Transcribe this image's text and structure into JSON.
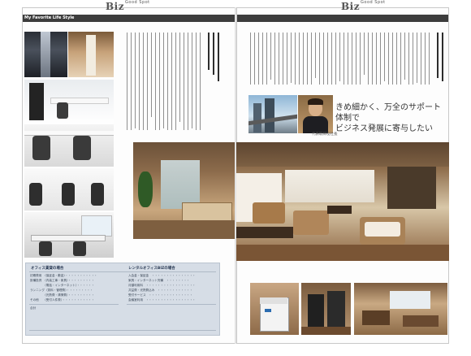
{
  "left_page": {
    "logo": "Biz",
    "logo_sub": "Good Spot",
    "section_label": "My Favorite Life Style",
    "photos": [
      {
        "name": "corridor-photo-1"
      },
      {
        "name": "corridor-photo-2"
      },
      {
        "name": "private-office-photo"
      },
      {
        "name": "desk-room-photo"
      },
      {
        "name": "workstation-photo"
      },
      {
        "name": "lounge-desk-photo"
      }
    ],
    "table": {
      "heading_left": "オフィス賃貸の場合",
      "heading_right": "レンタルオフィスBIZの場合",
      "rows_left": [
        "初期費用　〈保証金・敷金〉・・・・・・・・・・・",
        "設備投資　〈内装工事・家具〉・・・・・・・・・",
        "　　　　　〈電話・インターネット〉・・・・・・",
        "ランニング〈賃料・管理費〉・・・・・・・・・",
        "　　　　　〈光熱費・清掃費〉・・・・・・・・・",
        "その他　　〈受付人件費〉・・・・・・・・・・・",
        "合計"
      ],
      "rows_right": [
        "入会金・保証金　・・・・・・・・・・・・・・・",
        "家具・インターネット完備　・・・・・・・・",
        "月額利用料　・・・・・・・・・・・・・・・・・",
        "共益費・光熱費込み　・・・・・・・・・・・・",
        "受付サービス　・・・・・・・・・・・・・・・",
        "会議室利用　・・・・・・・・・・・・・・・・・"
      ],
      "left_total": "",
      "right_total": "",
      "compare_label": "",
      "note": ""
    }
  },
  "right_page": {
    "logo": "Biz",
    "logo_sub": "Good Spot",
    "headline_line1": "きめ細かく、万全のサポート体制で",
    "headline_line2": "ビジネス発展に寄与したい",
    "person_caption": "代表取締役社長",
    "photos": [
      {
        "name": "building-exterior-photo"
      },
      {
        "name": "president-portrait-photo"
      },
      {
        "name": "lounge-main-photo"
      },
      {
        "name": "copier-photo"
      },
      {
        "name": "coffee-machine-photo"
      },
      {
        "name": "cafe-space-photo"
      }
    ]
  },
  "colors": {
    "header_bar": "#3c3c3c",
    "table_bg": "#d6dde6",
    "table_accent": "#1f3c88",
    "wood": "#a77a4a"
  }
}
